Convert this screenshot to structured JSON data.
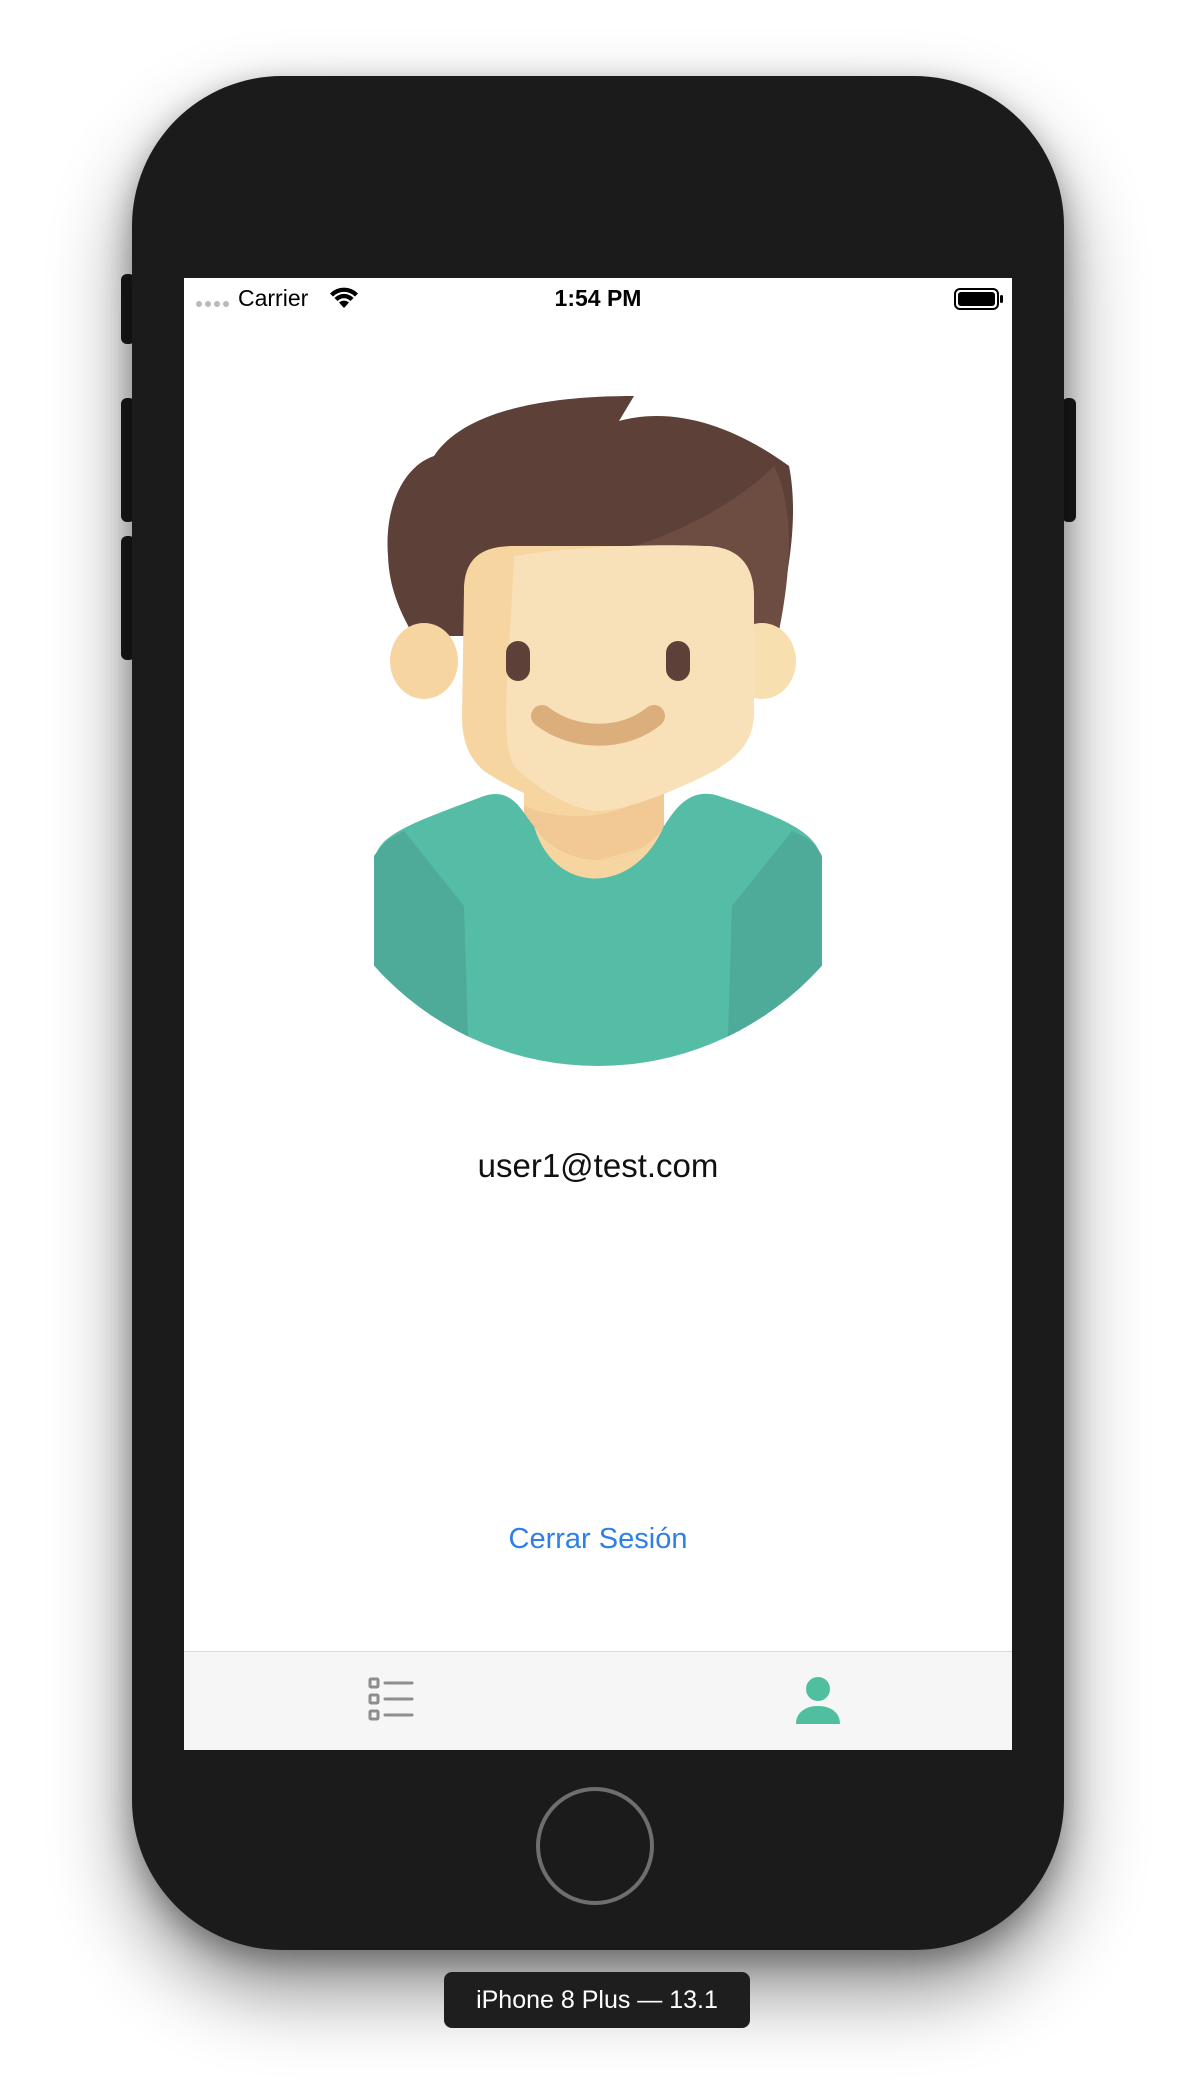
{
  "status_bar": {
    "carrier": "Carrier",
    "time": "1:54 PM",
    "wifi_icon": "wifi-icon",
    "battery_icon": "battery-icon",
    "signal_icon": "signal-dots-icon"
  },
  "profile": {
    "avatar_icon": "male-avatar-illustration",
    "email": "user1@test.com",
    "logout_label": "Cerrar Sesión"
  },
  "tab_bar": {
    "tabs": [
      {
        "icon": "checklist-icon",
        "selected": false
      },
      {
        "icon": "person-icon",
        "selected": true
      }
    ]
  },
  "device": {
    "label": "iPhone 8 Plus — 13.1",
    "home_button_icon": "home-button-circle"
  },
  "colors": {
    "accent_link": "#2f7fe8",
    "tab_selected": "#4fbf9f",
    "tab_unselected": "#8e8e8e",
    "device_frame": "#1b1b1b"
  }
}
